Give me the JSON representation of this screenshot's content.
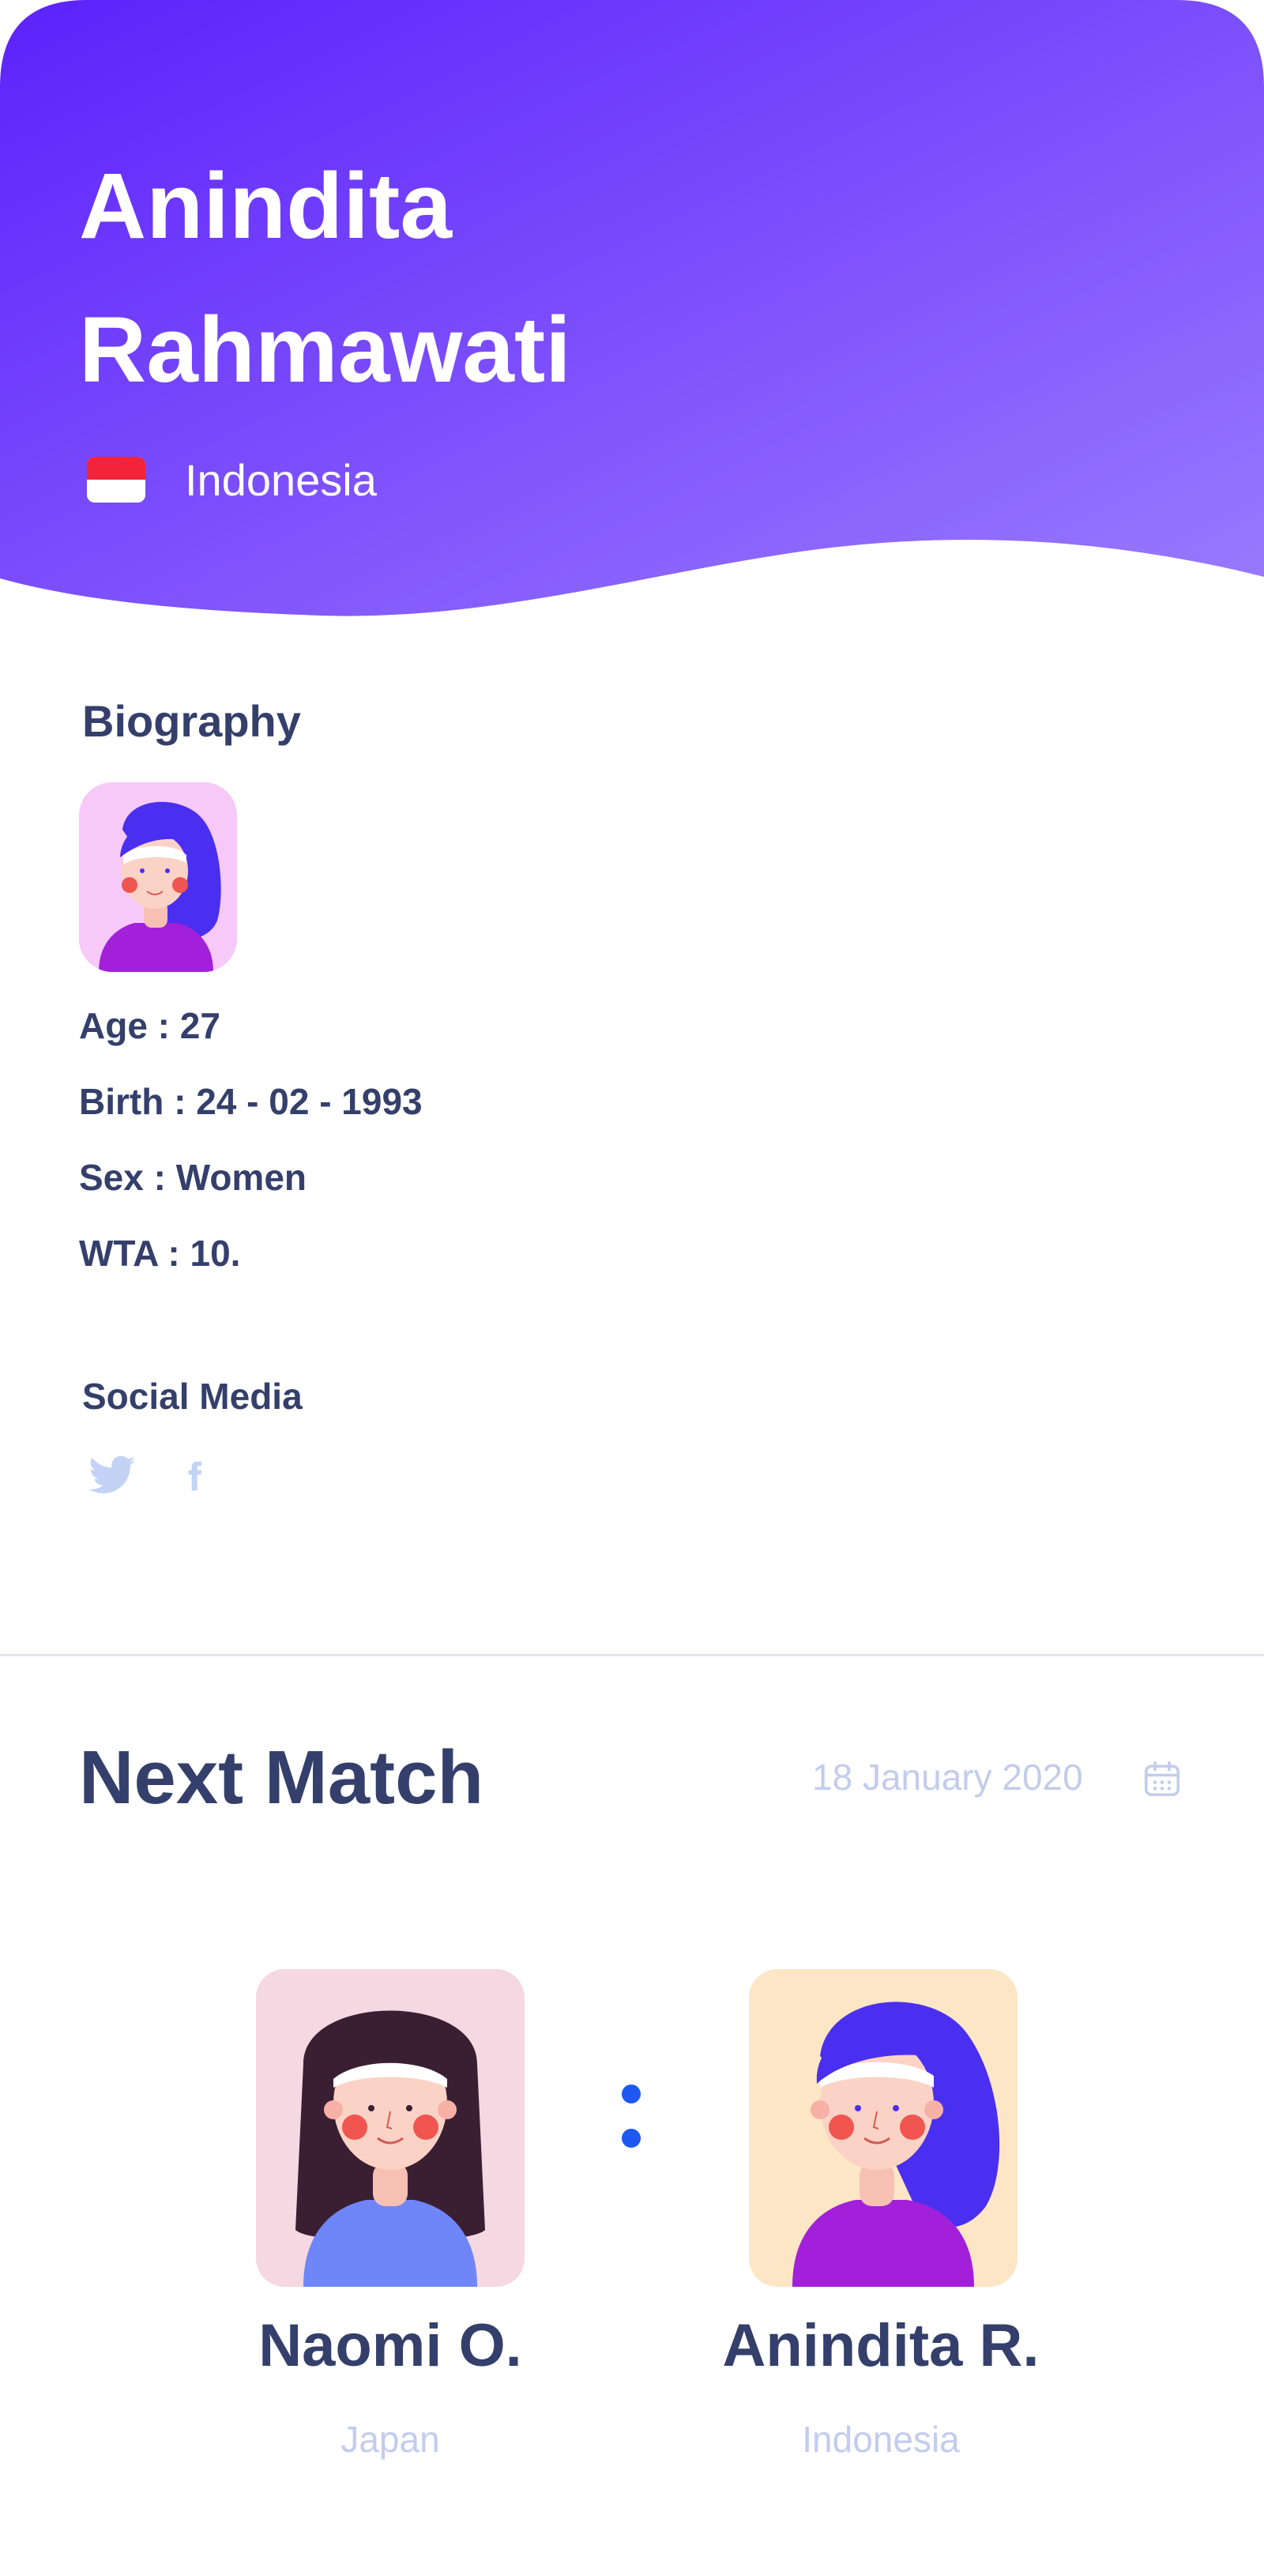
{
  "profile": {
    "first_name": "Anindita",
    "last_name": "Rahmawati",
    "country": "Indonesia",
    "flag_colors": [
      "#f2243b",
      "#ffffff"
    ]
  },
  "biography": {
    "title": "Biography",
    "age": "Age : 27",
    "birth": "Birth : 24 - 02 - 1993",
    "sex": "Sex : Women",
    "wta": "WTA : 10."
  },
  "social": {
    "title": "Social Media",
    "icons": [
      "twitter-icon",
      "facebook-icon"
    ]
  },
  "next_match": {
    "title": "Next Match",
    "date": "18 January 2020",
    "players": [
      {
        "name": "Naomi O.",
        "country": "Japan"
      },
      {
        "name": "Anindita R.",
        "country": "Indonesia"
      }
    ]
  },
  "colors": {
    "hero_gradient_start": "#5c22fb",
    "hero_gradient_end": "#9b7bfe",
    "text_dark": "#343f6b",
    "text_muted": "#c3ccec",
    "accent_blue": "#1d58f2"
  }
}
